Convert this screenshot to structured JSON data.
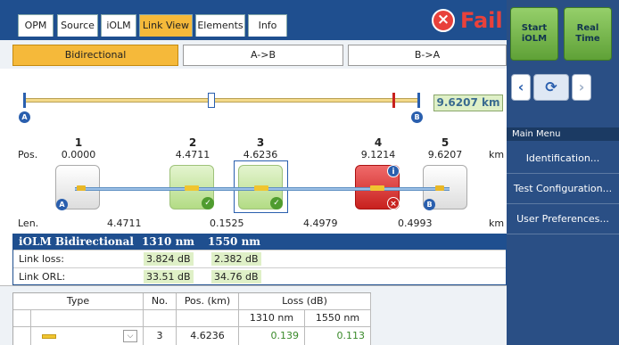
{
  "tabs": [
    {
      "label": "OPM"
    },
    {
      "label": "Source"
    },
    {
      "label": "iOLM"
    },
    {
      "label": "Link View"
    },
    {
      "label": "Elements"
    },
    {
      "label": "Info"
    }
  ],
  "status": {
    "label": "Fail",
    "color": "#e8413b",
    "icon": "close-icon"
  },
  "direction": {
    "options": [
      "Bidirectional",
      "A->B",
      "B->A"
    ],
    "selected": "Bidirectional"
  },
  "link_view": {
    "total_length": "9.6207 km",
    "endpoint_a": "A",
    "endpoint_b": "B",
    "pos_label": "Pos.",
    "len_label": "Len.",
    "unit": "km",
    "events": [
      {
        "number": "1",
        "pos": "0.0000",
        "kind": "launch",
        "status": ""
      },
      {
        "number": "2",
        "pos": "4.4711",
        "kind": "connector",
        "status": "pass"
      },
      {
        "number": "3",
        "pos": "4.6236",
        "kind": "connector",
        "status": "pass",
        "selected": true
      },
      {
        "number": "4",
        "pos": "9.1214",
        "kind": "connector",
        "status": "fail"
      },
      {
        "number": "5",
        "pos": "9.6207",
        "kind": "receive",
        "status": ""
      }
    ],
    "lengths": [
      "4.4711",
      "0.1525",
      "4.4979",
      "0.4993"
    ]
  },
  "results": {
    "title": "iOLM Bidirectional",
    "wavelengths": [
      "1310 nm",
      "1550 nm"
    ],
    "rows": [
      {
        "label": "Link loss:",
        "values": [
          "3.824 dB",
          "2.382 dB"
        ]
      },
      {
        "label": "Link ORL:",
        "values": [
          "33.51 dB",
          "34.76 dB"
        ]
      }
    ]
  },
  "event_table": {
    "headers": {
      "type": "Type",
      "no": "No.",
      "pos": "Pos. (km)",
      "loss": "Loss (dB)"
    },
    "subheaders": [
      "1310 nm",
      "1550 nm"
    ],
    "row": {
      "no": "3",
      "pos": "4.6236",
      "loss": [
        "0.139",
        "0.113"
      ]
    }
  },
  "sidebar": {
    "start_button": "Start iOLM",
    "realtime_button": "Real Time",
    "menu_header": "Main Menu",
    "menu_items": [
      "Identification...",
      "Test Configuration...",
      "User Preferences..."
    ]
  }
}
